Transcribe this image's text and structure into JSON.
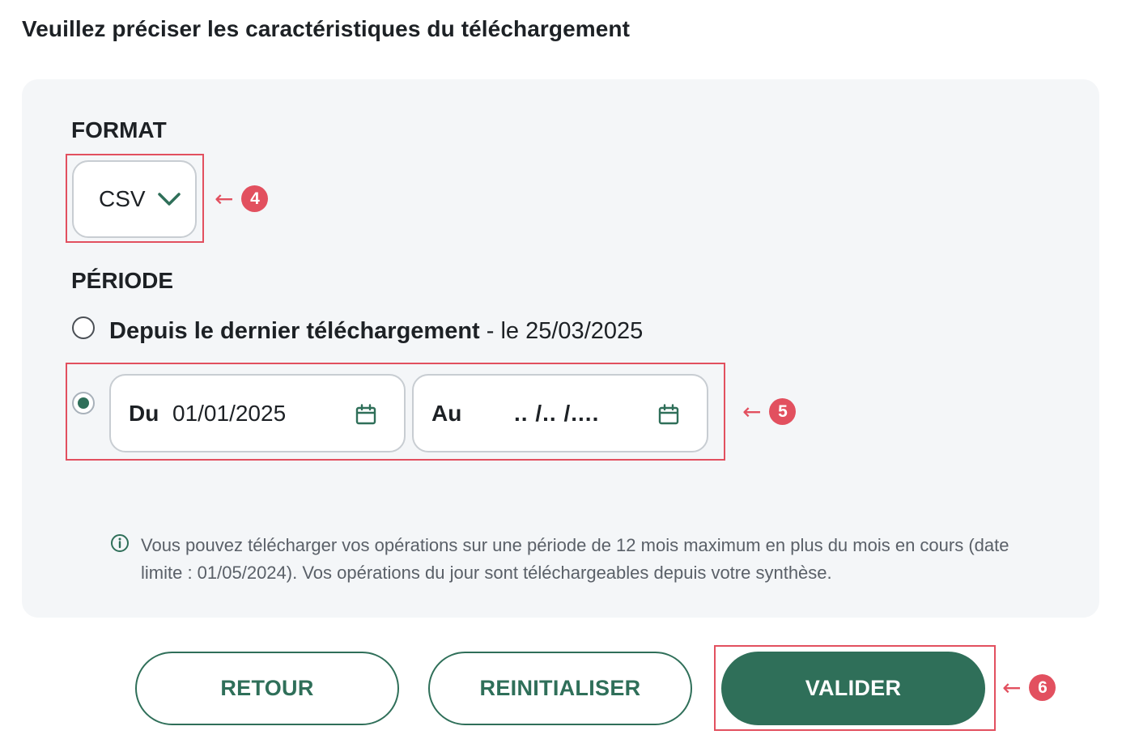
{
  "title": "Veuillez préciser les caractéristiques du téléchargement",
  "format": {
    "label": "FORMAT",
    "selected": "CSV"
  },
  "periode": {
    "label": "PÉRIODE",
    "option_last": {
      "label_strong": "Depuis le dernier téléchargement",
      "label_rest": " - le 25/03/2025",
      "checked": false
    },
    "option_range": {
      "checked": true,
      "from_label": "Du",
      "from_value": "01/01/2025",
      "to_label": "Au",
      "to_value": ".. /.. /...."
    }
  },
  "info_text": "Vous pouvez télécharger vos opérations sur une période de 12 mois maximum en plus du mois en cours (date limite : 01/05/2024). Vos opérations du jour sont téléchargeables depuis votre synthèse.",
  "buttons": {
    "back": "RETOUR",
    "reset": "REINITIALISER",
    "submit": "VALIDER"
  },
  "callouts": {
    "format": "4",
    "period": "5",
    "submit": "6",
    "arrow": "←"
  },
  "colors": {
    "accent": "#2f6f59",
    "highlight": "#e2505f",
    "panel": "#f4f6f8"
  },
  "icons": [
    "chevron-down-icon",
    "calendar-icon",
    "info-icon",
    "arrow-left-icon"
  ]
}
